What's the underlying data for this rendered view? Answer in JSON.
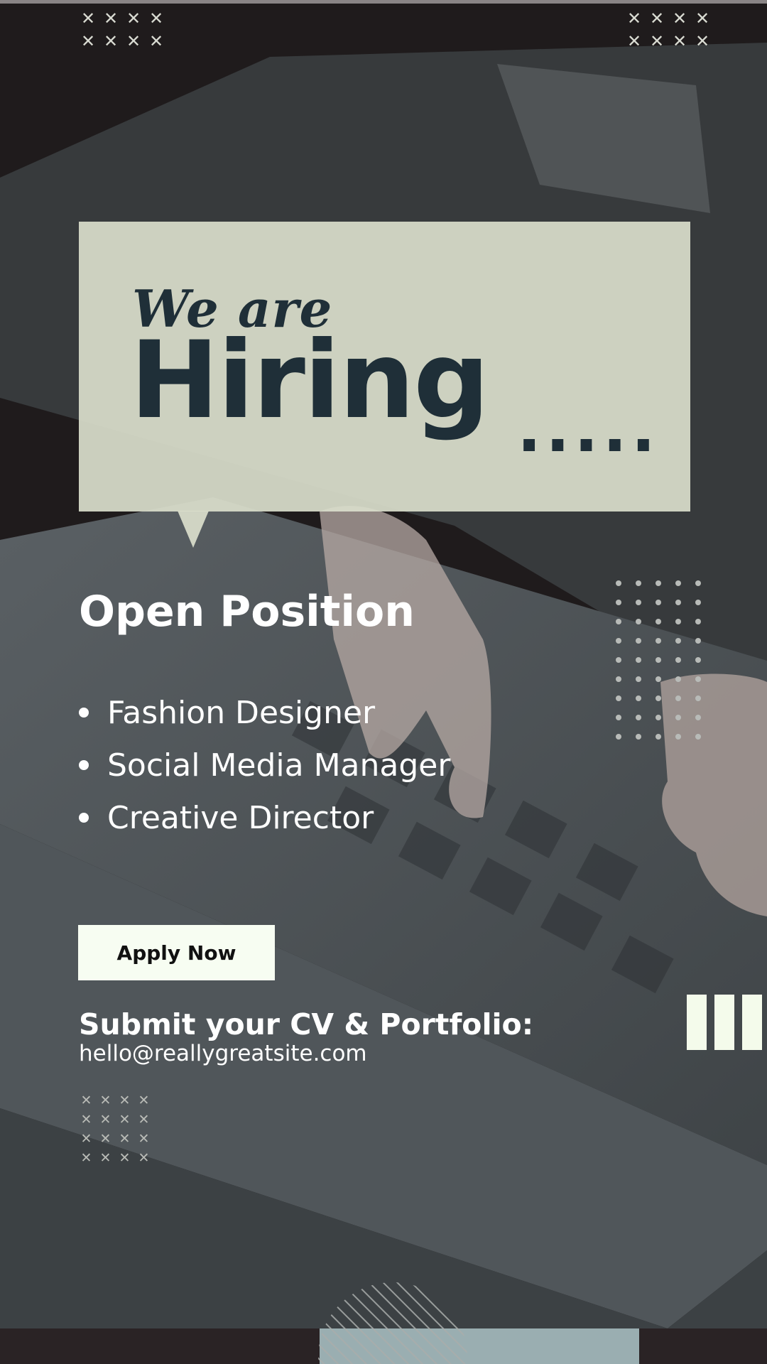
{
  "headline": {
    "line1": "We are",
    "line2": "Hiring",
    "ellipsis": "....."
  },
  "section_title": "Open Position",
  "positions": [
    {
      "label": "Fashion Designer"
    },
    {
      "label": "Social Media Manager"
    },
    {
      "label": "Creative Director"
    }
  ],
  "cta": {
    "label": "Apply Now"
  },
  "contact": {
    "heading": "Submit your CV & Portfolio:",
    "email": "hello@reallygreatsite.com"
  },
  "colors": {
    "background": "#1f1b1c",
    "bubble": "#dadecc",
    "headline_text": "#1f2f38",
    "button": "#f7fdf2",
    "accent_bars": "#f4fbeb"
  },
  "icons": {
    "pattern": "x-mark-pattern-icon",
    "dots": "dot-pattern-icon",
    "bars": "bars-icon",
    "halftone": "striped-circle-icon"
  }
}
